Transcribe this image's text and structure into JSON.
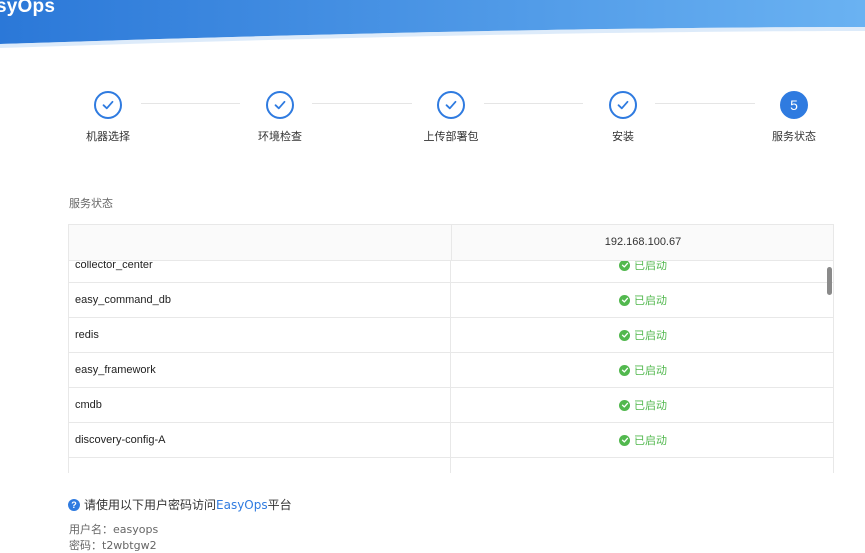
{
  "header": {
    "logo_text": "syOps",
    "gradient_start": "#2b78d8",
    "gradient_end": "#6ab2f2"
  },
  "stepper": {
    "steps": [
      {
        "label": "机器选择",
        "status": "done"
      },
      {
        "label": "环境检查",
        "status": "done"
      },
      {
        "label": "上传部署包",
        "status": "done"
      },
      {
        "label": "安装",
        "status": "done"
      },
      {
        "label": "服务状态",
        "status": "active",
        "number": "5"
      }
    ],
    "accent_color": "#2f7be0"
  },
  "section": {
    "title": "服务状态"
  },
  "table": {
    "columns": [
      "",
      "192.168.100.67"
    ],
    "rows": [
      {
        "name": "collector_center",
        "status": "已启动"
      },
      {
        "name": "easy_command_db",
        "status": "已启动"
      },
      {
        "name": "redis",
        "status": "已启动"
      },
      {
        "name": "easy_framework",
        "status": "已启动"
      },
      {
        "name": "cmdb",
        "status": "已启动"
      },
      {
        "name": "discovery-config-A",
        "status": "已启动"
      }
    ],
    "status_color": "#52b84e"
  },
  "footer": {
    "notice_prefix": "请使用以下用户密码访问",
    "notice_brand": "EasyOps",
    "notice_suffix": "平台",
    "username_label": "用户名：",
    "username": "easyops",
    "password_label": "密码：",
    "password": "t2wbtgw2"
  }
}
